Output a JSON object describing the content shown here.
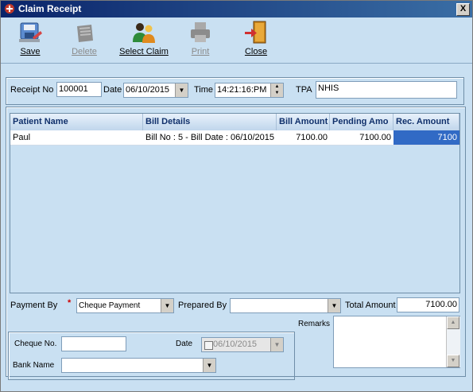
{
  "window": {
    "title": "Claim Receipt",
    "close_glyph": "X"
  },
  "toolbar": {
    "save": "Save",
    "delete": "Delete",
    "select_claim": "Select Claim",
    "print": "Print",
    "close": "Close"
  },
  "header": {
    "receipt_no_label": "Receipt No",
    "receipt_no_value": "100001",
    "date_label": "Date",
    "date_value": "06/10/2015",
    "time_label": "Time",
    "time_value": "14:21:16:PM",
    "tpa_label": "TPA",
    "tpa_value": "NHIS"
  },
  "grid": {
    "columns": [
      "Patient Name",
      "Bill Details",
      "Bill Amount",
      "Pending Amo",
      "Rec. Amount"
    ],
    "rows": [
      {
        "patient_name": "Paul",
        "bill_details": "Bill No : 5 - Bill Date : 06/10/2015",
        "bill_amount": "7100.00",
        "pending_amount": "7100.00",
        "rec_amount": "7100"
      }
    ]
  },
  "payment": {
    "payment_by_label": "Payment By",
    "required_mark": "*",
    "payment_by_value": "Cheque Payment",
    "prepared_by_label": "Prepared By",
    "prepared_by_value": "",
    "total_amount_label": "Total Amount",
    "total_amount_value": "7100.00"
  },
  "cheque": {
    "cheque_no_label": "Cheque No.",
    "cheque_no_value": "",
    "date_label": "Date",
    "date_value": "06/10/2015",
    "bank_name_label": "Bank Name",
    "bank_name_value": ""
  },
  "remarks": {
    "label": "Remarks",
    "value": ""
  },
  "colors": {
    "background": "#c9e0f2",
    "title_bar": "#0a246a",
    "selection": "#316ac5",
    "header_text": "#10306b"
  },
  "icons": [
    "claim-app-icon",
    "save-icon",
    "delete-icon",
    "select-claim-icon",
    "print-icon",
    "close-door-icon"
  ]
}
